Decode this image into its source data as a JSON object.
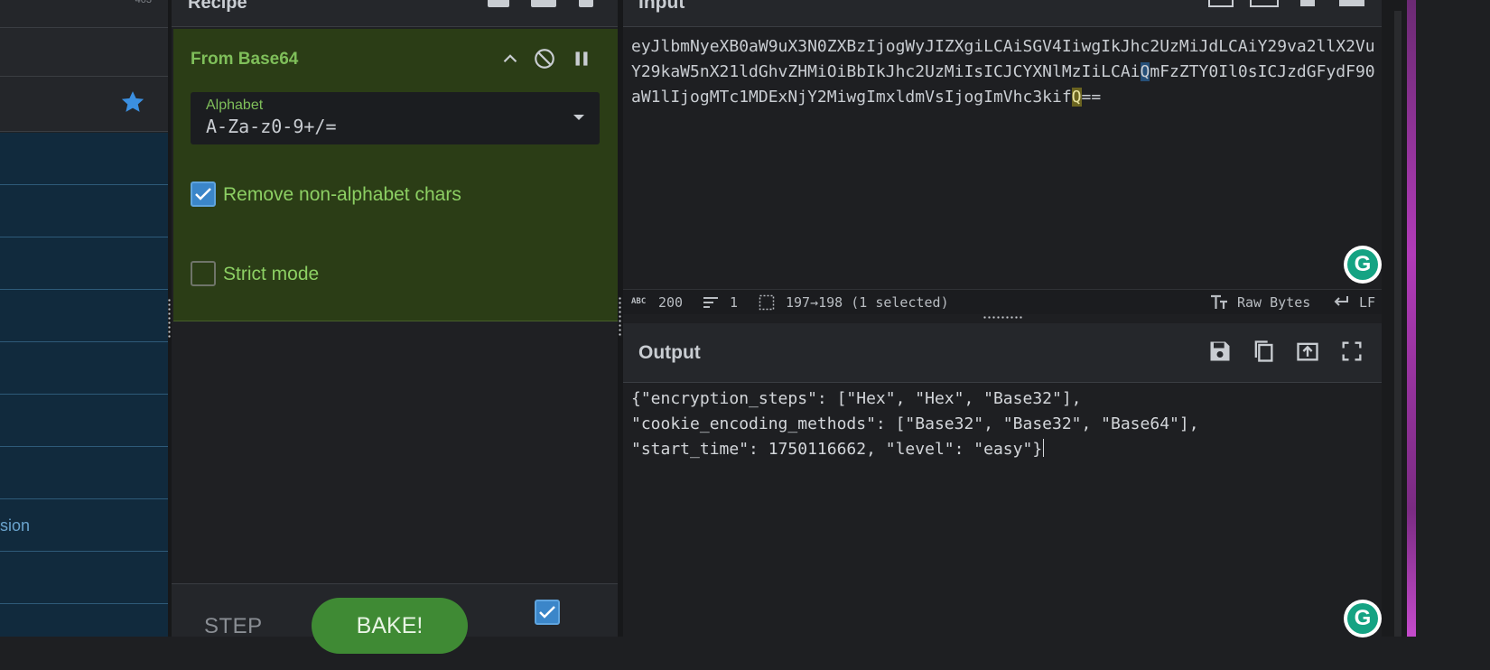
{
  "operations_panel": {
    "top_count": "403",
    "partial_item_label": "sion",
    "favourites_icon": "star-icon",
    "item_count": 10
  },
  "recipe": {
    "title": "Recipe",
    "operation": {
      "title": "From Base64",
      "alphabet_label": "Alphabet",
      "alphabet_value": "A-Za-z0-9+/=",
      "remove_non_alphabet_label": "Remove non-alphabet chars",
      "remove_non_alphabet_checked": true,
      "strict_mode_label": "Strict mode",
      "strict_mode_checked": false
    },
    "step_label": "STEP",
    "bake_label": "BAKE!",
    "auto_bake_checked": true
  },
  "input": {
    "title": "Input",
    "text_before": "eyJlbmNyeXB0aW9uX3N0ZXBzIjogWyJIZXgiLCAiSGV4IiwgIkJhc2UzMiJdLCAiY29va2llX2VuY29kaW5nX21ldGhvZHMiOiBbIkJhc2UzMiIsICJCYXNlMzIiLCAi",
    "text_selected": "Q",
    "text_middle": "mFzZTY0Il0sICJzdGFydF90aW1lIjogMTc1MDExNjY2MiwgImxldmVsIjogImVhc3kif",
    "text_match": "Q",
    "text_after": "==",
    "status": {
      "length": "200",
      "lines": "1",
      "selection": "197→198 (1 selected)",
      "encoding": "Raw Bytes",
      "eol": "LF"
    }
  },
  "output": {
    "title": "Output",
    "text": "{\"encryption_steps\": [\"Hex\", \"Hex\", \"Base32\"],\n\"cookie_encoding_methods\": [\"Base32\", \"Base32\", \"Base64\"],\n\"start_time\": 1750116662, \"level\": \"easy\"}"
  },
  "colors": {
    "recipe_card_bg": "#2b3d16",
    "accent_green": "#7fbf5a",
    "bake_green": "#3f8a34",
    "checkbox_blue": "#3b86c9",
    "operations_blue": "#112a3d",
    "grammarly_green": "#15a383"
  }
}
